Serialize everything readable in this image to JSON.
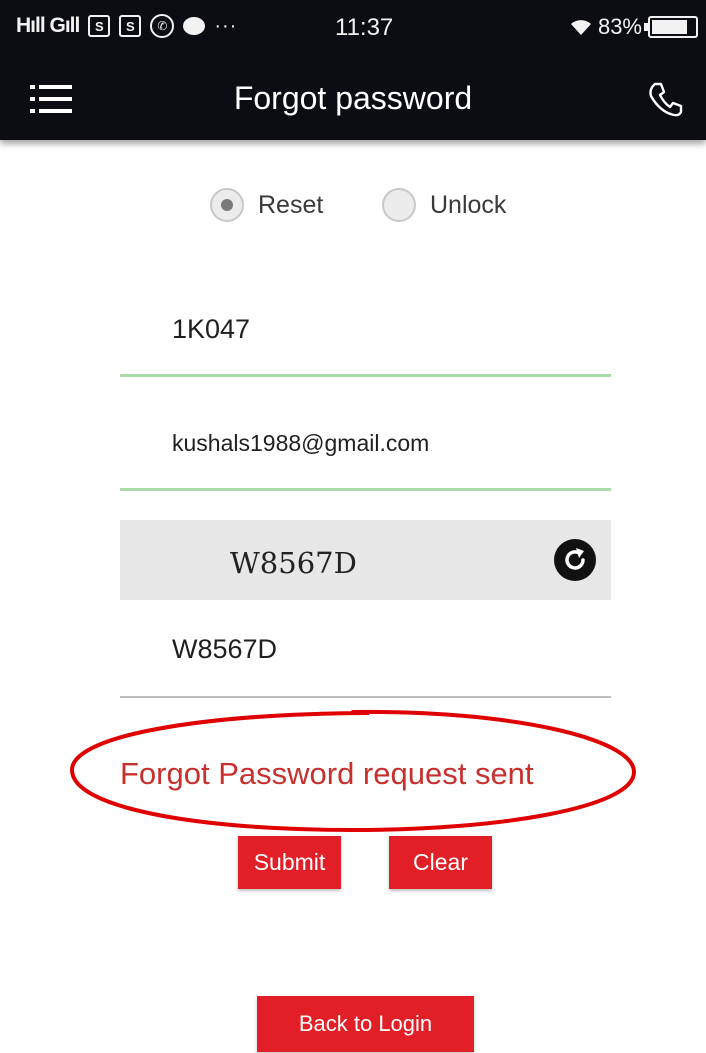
{
  "status_bar": {
    "signal": "Hıll Gıll",
    "time": "11:37",
    "battery": "83%",
    "battery_level": 0.83,
    "icons": [
      "signal-icon",
      "sim-icon",
      "whatsapp-icon",
      "chat-icon",
      "more-icon",
      "wifi-icon",
      "battery-icon"
    ]
  },
  "app_bar": {
    "title": "Forgot password",
    "menu_icon": "menu-icon",
    "phone_icon": "phone-icon"
  },
  "mode_options": [
    {
      "label": "Reset",
      "selected": true
    },
    {
      "label": "Unlock",
      "selected": false
    }
  ],
  "form": {
    "user_id": "1K047",
    "email": "kushals1988@gmail.com",
    "captcha_image_text": "W8567D",
    "captcha_input": "W8567D",
    "refresh_icon": "refresh-icon"
  },
  "status_message": "Forgot Password request sent",
  "buttons": {
    "submit": "Submit",
    "clear": "Clear",
    "back_to_login": "Back to Login"
  },
  "colors": {
    "bar_background": "#0b0d12",
    "accent_red": "#e21e26",
    "message_red": "#c7302c",
    "annotation_red": "#e00000",
    "active_underline": "#a9dba7",
    "inactive_underline": "#bdbdbd",
    "captcha_background": "#e7e7e7"
  }
}
